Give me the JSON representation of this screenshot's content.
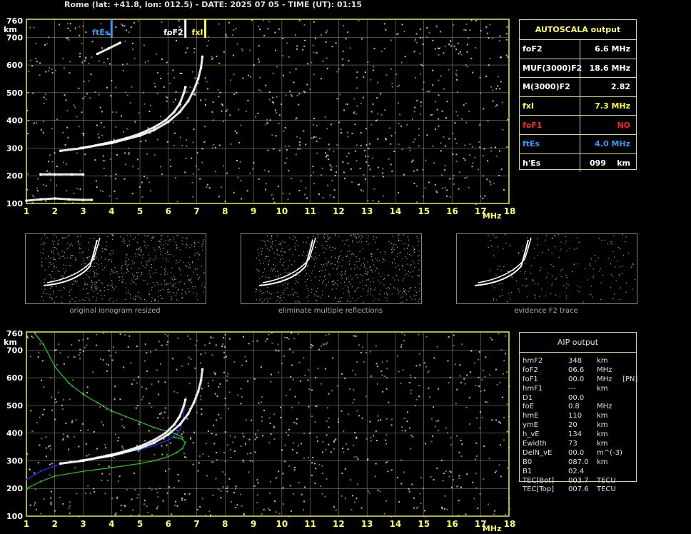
{
  "header": {
    "title": "Rome (lat: +41.8, lon: 012.5) - DATE: 2025 07 05 - TIME (UT): 01:15"
  },
  "colors": {
    "grid": "#e8e85a",
    "trace": "#ffffff",
    "green": "#22cc22",
    "blue": "#2233ff",
    "fxI": "#ffff33",
    "ftEs": "#3399ff",
    "foF1": "#ff2222"
  },
  "chart_data": [
    {
      "type": "scatter",
      "title": "",
      "xlabel": "MHz",
      "ylabel": "km",
      "xlim": [
        1,
        18
      ],
      "ylim": [
        100,
        760
      ],
      "x_ticks": [
        1,
        2,
        3,
        4,
        5,
        6,
        7,
        8,
        9,
        10,
        11,
        12,
        13,
        14,
        15,
        16,
        17,
        18
      ],
      "y_ticks": [
        100,
        200,
        300,
        400,
        500,
        600,
        700,
        760
      ],
      "grid": true,
      "markers": [
        {
          "name": "ftEs",
          "x": 4.0,
          "color": "#3399ff"
        },
        {
          "name": "foF2",
          "x": 6.6,
          "color": "#ffffff"
        },
        {
          "name": "fxI",
          "x": 7.3,
          "color": "#ffff33"
        }
      ],
      "series": [
        {
          "x": [
            2.2,
            3,
            4,
            4.5,
            5,
            5.5,
            5.9,
            6.2,
            6.4,
            6.55,
            6.6
          ],
          "y": [
            290,
            300,
            322,
            335,
            352,
            375,
            400,
            430,
            460,
            500,
            520
          ]
        },
        {
          "x": [
            2.9,
            4,
            5,
            5.5,
            6,
            6.4,
            6.7,
            6.9,
            7.05,
            7.15,
            7.2
          ],
          "y": [
            300,
            318,
            345,
            365,
            395,
            430,
            470,
            510,
            550,
            590,
            630
          ]
        },
        {
          "x": [
            1.5,
            2,
            2.6,
            3
          ],
          "y": [
            205,
            205,
            205,
            205
          ]
        },
        {
          "x": [
            1,
            1.5,
            2,
            2.5,
            3,
            3.3
          ],
          "y": [
            110,
            115,
            118,
            115,
            113,
            113
          ]
        },
        {
          "x": [
            3.5,
            3.9,
            4.3
          ],
          "y": [
            640,
            660,
            680
          ]
        }
      ]
    },
    {
      "type": "line",
      "title": "",
      "xlabel": "MHz",
      "ylabel": "km",
      "xlim": [
        1,
        18
      ],
      "ylim": [
        100,
        760
      ],
      "x_ticks": [
        1,
        2,
        3,
        4,
        5,
        6,
        7,
        8,
        9,
        10,
        11,
        12,
        13,
        14,
        15,
        16,
        17,
        18
      ],
      "y_ticks": [
        100,
        200,
        300,
        400,
        500,
        600,
        700,
        760
      ],
      "grid": true,
      "series": [
        {
          "x": [
            1.3,
            1.6,
            2,
            2.5,
            3,
            3.5,
            4,
            4.5,
            5,
            5.5,
            6,
            6.3,
            6.5
          ],
          "y": [
            760,
            720,
            640,
            580,
            540,
            510,
            480,
            460,
            440,
            420,
            405,
            395,
            385
          ],
          "color": "#22cc22"
        },
        {
          "x": [
            1,
            1.5,
            2,
            3,
            4,
            5,
            5.5,
            6,
            6.3,
            6.5,
            6.6,
            6.5,
            6.2
          ],
          "y": [
            200,
            225,
            245,
            262,
            275,
            290,
            300,
            315,
            330,
            345,
            365,
            378,
            385
          ],
          "color": "#22cc22"
        },
        {
          "x": [
            1,
            1.5,
            2,
            3,
            4,
            5,
            5.5,
            6,
            6.2,
            6.4,
            6.5,
            6.6
          ],
          "y": [
            232,
            262,
            282,
            302,
            322,
            340,
            355,
            375,
            390,
            410,
            440,
            520
          ],
          "color": "#2233ff"
        },
        {
          "x": [
            2.2,
            3,
            4,
            4.5,
            5,
            5.5,
            5.9,
            6.2,
            6.4,
            6.55,
            6.6
          ],
          "y": [
            290,
            300,
            322,
            335,
            352,
            375,
            400,
            430,
            460,
            500,
            520
          ],
          "color": "#ffffff"
        },
        {
          "x": [
            2.9,
            4,
            5,
            5.5,
            6,
            6.4,
            6.7,
            6.9,
            7.05,
            7.15,
            7.2
          ],
          "y": [
            300,
            318,
            345,
            365,
            395,
            430,
            470,
            510,
            550,
            590,
            630
          ],
          "color": "#ffffff"
        }
      ]
    }
  ],
  "autoscala": {
    "title": "AUTOSCALA output",
    "rows": [
      {
        "label": "foF2",
        "value": "6.6 MHz",
        "color": "#ffffff"
      },
      {
        "label": "MUF(3000)F2",
        "value": "18.6 MHz",
        "color": "#ffffff"
      },
      {
        "label": "M(3000)F2",
        "value": "2.82",
        "color": "#ffffff"
      },
      {
        "label": "fxI",
        "value": "7.3 MHz",
        "color": "#ffff33"
      },
      {
        "label": "foF1",
        "value": "NO",
        "color": "#ff2222"
      },
      {
        "label": "ftEs",
        "value": "4.0 MHz",
        "color": "#3399ff"
      },
      {
        "label": "h'Es",
        "value": "099    km",
        "color": "#ffffff"
      }
    ]
  },
  "thumbs": [
    {
      "caption": "original ionogram resized"
    },
    {
      "caption": "eliminate multiple reflections"
    },
    {
      "caption": "evidence F2 trace"
    }
  ],
  "aip": {
    "title": "AIP output",
    "rows": [
      [
        "hmF2",
        "348",
        "km",
        ""
      ],
      [
        "foF2",
        "06.6",
        "MHz",
        ""
      ],
      [
        "foF1",
        "00.0",
        "MHz",
        "[PN]"
      ],
      [
        "hmF1",
        "---",
        "km",
        ""
      ],
      [
        "D1",
        "00.0",
        "",
        ""
      ],
      [
        "foE",
        "0.8",
        "MHz",
        ""
      ],
      [
        "hmE",
        "110",
        "km",
        ""
      ],
      [
        "ymE",
        "20",
        "km",
        ""
      ],
      [
        "h_vE",
        "134",
        "km",
        ""
      ],
      [
        "Ewidth",
        "73",
        "km",
        ""
      ],
      [
        "DelN_vE",
        "00.0",
        "m^(-3)",
        ""
      ],
      [
        "B0",
        "087.0",
        "km",
        ""
      ],
      [
        "B1",
        "02.4",
        "",
        ""
      ],
      [
        "TEC[Bot]",
        "003.7",
        "TECU",
        ""
      ],
      [
        "TEC[Top]",
        "007.6",
        "TECU",
        ""
      ]
    ]
  }
}
